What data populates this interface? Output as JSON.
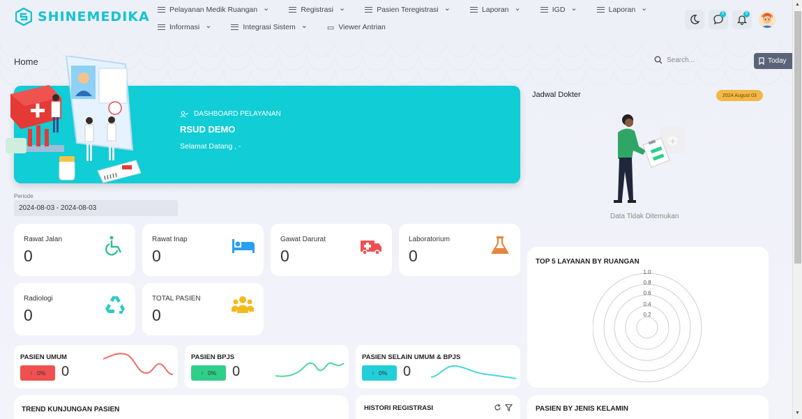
{
  "app": {
    "logo_text": "SHINEMEDIKA"
  },
  "nav": {
    "row1": [
      {
        "label": "Pelayanan Medik Ruangan",
        "has_dropdown": true
      },
      {
        "label": "Registrasi",
        "has_dropdown": true
      },
      {
        "label": "Pasien Teregistrasi",
        "has_dropdown": true
      },
      {
        "label": "Laporan",
        "has_dropdown": true
      },
      {
        "label": "IGD",
        "has_dropdown": true
      },
      {
        "label": "Laporan",
        "has_dropdown": true
      }
    ],
    "row2": [
      {
        "label": "Informasi",
        "has_dropdown": true
      },
      {
        "label": "Integrasi Sistem",
        "has_dropdown": true
      },
      {
        "label": "Viewer Antrian",
        "has_dropdown": false
      }
    ]
  },
  "header": {
    "chat_count": "0",
    "notif_count": "0"
  },
  "breadcrumb": "Home",
  "search": {
    "placeholder": "Search..."
  },
  "today_button": "Today",
  "hero": {
    "subtitle": "DASHBOARD PELAYANAN",
    "title": "RSUD DEMO",
    "welcome": "Selamat Datang , -"
  },
  "periode": {
    "label": "Periode",
    "value": "2024-08-03 - 2024-08-03"
  },
  "stats": [
    {
      "label": "Rawat Jalan",
      "value": "0",
      "icon": "wheelchair-icon",
      "color": "#2fbf8f"
    },
    {
      "label": "Rawat Inap",
      "value": "0",
      "icon": "bed-icon",
      "color": "#2a9df4"
    },
    {
      "label": "Gawat Darurat",
      "value": "0",
      "icon": "ambulance-icon",
      "color": "#f0504f"
    },
    {
      "label": "Laboratorium",
      "value": "0",
      "icon": "flask-icon",
      "color": "#e8843c"
    },
    {
      "label": "Radiologi",
      "value": "0",
      "icon": "recycle-icon",
      "color": "#2fcbbf"
    },
    {
      "label": "TOTAL PASIEN",
      "value": "0",
      "icon": "users-icon",
      "color": "#f5b91c"
    }
  ],
  "patient_types": [
    {
      "label": "PASIEN UMUM",
      "percent": "0%",
      "value": "0",
      "color": "#f0504f"
    },
    {
      "label": "PASIEN BPJS",
      "percent": "0%",
      "value": "0",
      "color": "#2fcf8a"
    },
    {
      "label": "PASIEN SELAIN UMUM & BPJS",
      "percent": "0%",
      "value": "0",
      "color": "#22cfd8"
    }
  ],
  "jadwal": {
    "title": "Jadwal Dokter",
    "date": "2024 August 03",
    "empty_text": "Data Tidak Ditemukan"
  },
  "top5": {
    "title": "TOP 5 LAYANAN BY RUANGAN",
    "ticks": [
      "1.0",
      "0.8",
      "0.6",
      "0.4",
      "0.2"
    ]
  },
  "trend": {
    "title": "TREND KUNJUNGAN PASIEN"
  },
  "histori": {
    "title": "HISTORI REGISTRASI"
  },
  "gender": {
    "title": "PASIEN BY JENIS KELAMIN"
  }
}
